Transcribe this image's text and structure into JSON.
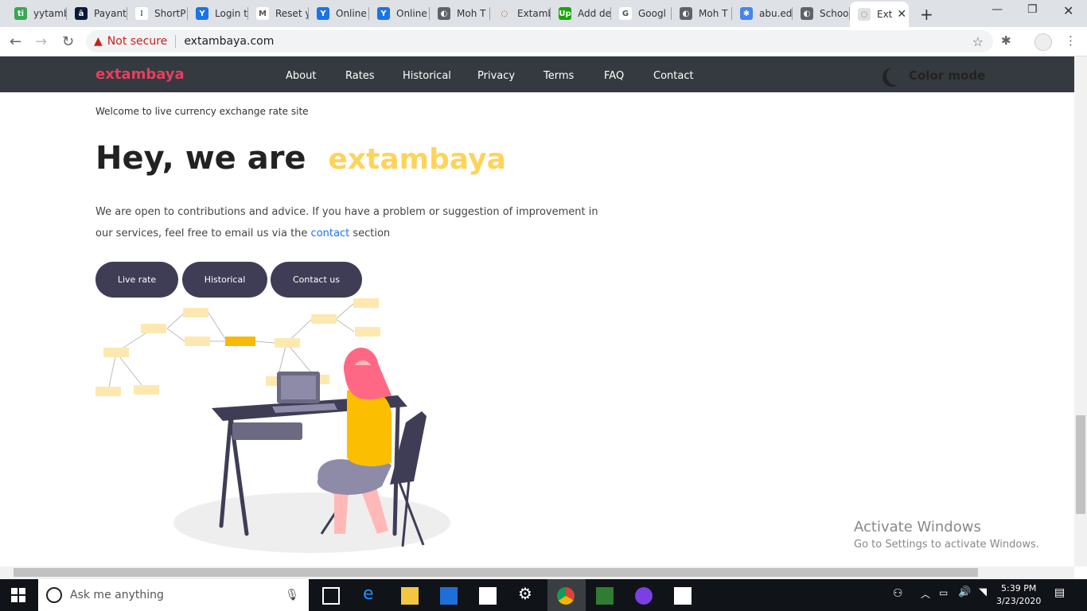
{
  "browser": {
    "tabs": [
      {
        "label": "yytamb",
        "icon": "tab-favicon",
        "color": "#34a853",
        "glyph": "ti"
      },
      {
        "label": "Payant",
        "icon": "tab-favicon",
        "color": "#0b1a3a",
        "glyph": "ā"
      },
      {
        "label": "ShortP",
        "icon": "tab-favicon",
        "color": "#ffffff",
        "glyph": "⁝"
      },
      {
        "label": "Login t",
        "icon": "tab-favicon",
        "color": "#1a73e8",
        "glyph": "Y"
      },
      {
        "label": "Reset y",
        "icon": "tab-favicon",
        "color": "#ffffff",
        "glyph": "M"
      },
      {
        "label": "Online",
        "icon": "tab-favicon",
        "color": "#1a73e8",
        "glyph": "Y"
      },
      {
        "label": "Online",
        "icon": "tab-favicon",
        "color": "#1a73e8",
        "glyph": "Y"
      },
      {
        "label": "Moh T",
        "icon": "tab-favicon",
        "color": "#5f6368",
        "glyph": "◐"
      },
      {
        "label": "Extamb",
        "icon": "tab-favicon",
        "color": "#e0e0e0",
        "glyph": "◌"
      },
      {
        "label": "Add de",
        "icon": "tab-favicon",
        "color": "#14a800",
        "glyph": "Up"
      },
      {
        "label": "Googl",
        "icon": "tab-favicon",
        "color": "#ffffff",
        "glyph": "G"
      },
      {
        "label": "Moh T",
        "icon": "tab-favicon",
        "color": "#5f6368",
        "glyph": "◐"
      },
      {
        "label": "abu.ed",
        "icon": "tab-favicon",
        "color": "#4285f4",
        "glyph": "✱"
      },
      {
        "label": "School",
        "icon": "tab-favicon",
        "color": "#5f6368",
        "glyph": "◐"
      },
      {
        "label": "Ext",
        "icon": "tab-favicon",
        "color": "#e0e0e0",
        "glyph": "◌"
      }
    ],
    "security_label": "Not secure",
    "url": "extambaya.com"
  },
  "site": {
    "logo": "extambaya",
    "nav": [
      "About",
      "Rates",
      "Historical",
      "Privacy",
      "Terms",
      "FAQ",
      "Contact"
    ],
    "color_mode": "Color mode",
    "welcome": "Welcome to live currency exchange rate site",
    "hero_prefix": "Hey, we are",
    "hero_brand": "extambaya",
    "para_before": "We are open to contributions and advice. If you have a problem or suggestion of improvement in our services, feel free to email us via the",
    "para_link": "contact",
    "para_after": "section",
    "buttons": [
      "Live rate",
      "Historical",
      "Contact us"
    ],
    "brand_color": "#ffd35a",
    "nav_bg": "#343a40",
    "button_bg": "#3f3d56"
  },
  "watermark": {
    "title": "Activate Windows",
    "subtitle": "Go to Settings to activate Windows."
  },
  "taskbar": {
    "search_placeholder": "Ask me anything",
    "time": "5:39 PM",
    "date": "3/23/2020"
  }
}
